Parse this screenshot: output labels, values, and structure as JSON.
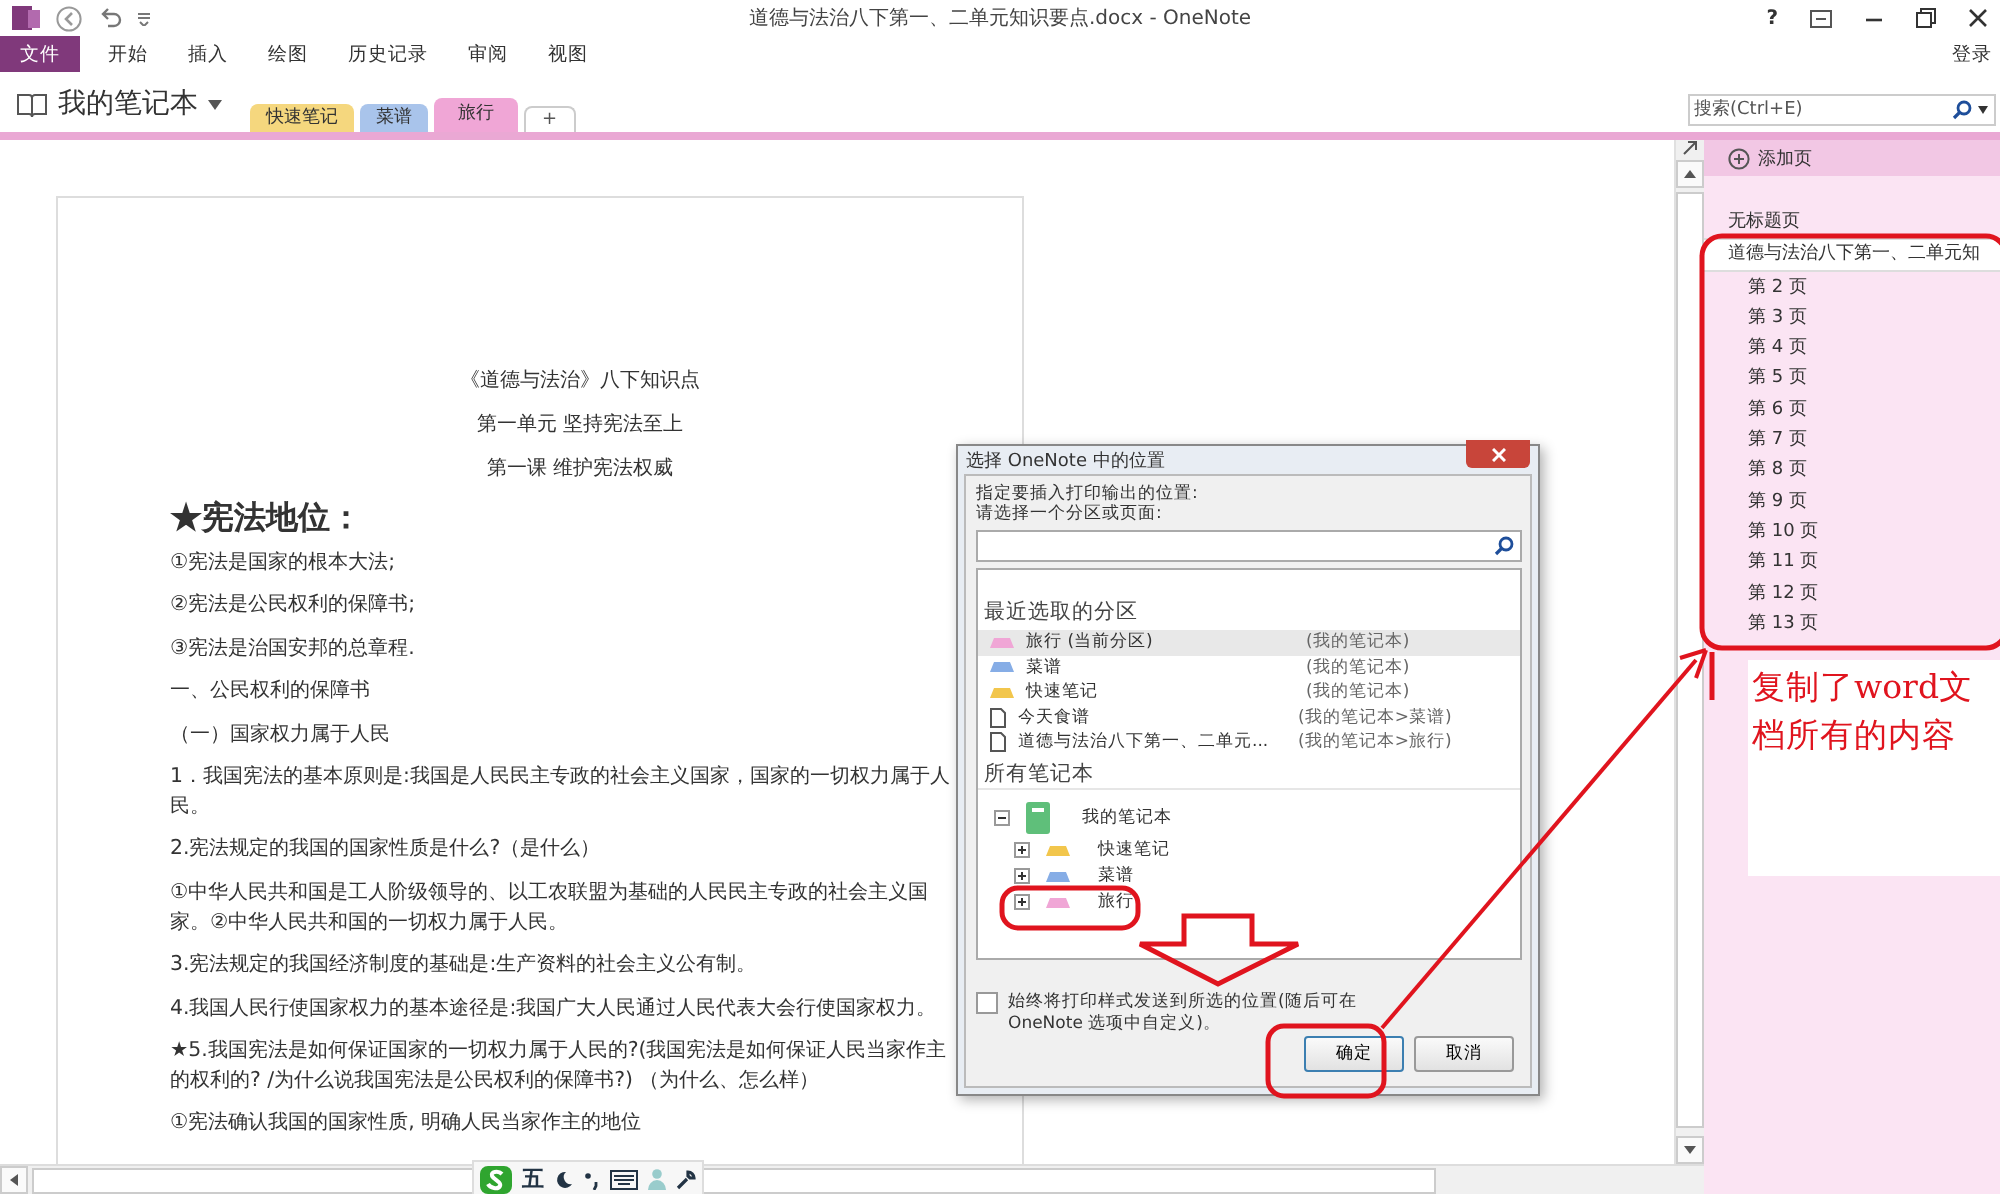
{
  "window": {
    "title": "道德与法治八下第一、二单元知识要点.docx - OneNote",
    "help": "?",
    "sign_in": "登录"
  },
  "ribbon": {
    "tabs": [
      {
        "label": "文件",
        "kind": "file"
      },
      {
        "label": "开始",
        "kind": "tab"
      },
      {
        "label": "插入",
        "kind": "tab"
      },
      {
        "label": "绘图",
        "kind": "tab"
      },
      {
        "label": "历史记录",
        "kind": "tab"
      },
      {
        "label": "审阅",
        "kind": "tab"
      },
      {
        "label": "视图",
        "kind": "tab"
      }
    ]
  },
  "notebook": {
    "name": "我的笔记本",
    "sections": [
      {
        "label": "快速笔记",
        "color": "#f5d77e",
        "selected": false
      },
      {
        "label": "菜谱",
        "color": "#a9c4eb",
        "selected": false
      },
      {
        "label": "旅行",
        "color": "#f0a6d6",
        "selected": true
      }
    ],
    "add_section": "+",
    "search": {
      "placeholder": "搜索(Ctrl+E)"
    }
  },
  "document": {
    "lines": [
      {
        "kind": "title",
        "text": "《道德与法治》八下知识点"
      },
      {
        "kind": "title",
        "text": "第一单元 坚持宪法至上"
      },
      {
        "kind": "title",
        "text": "第一课 维护宪法权威"
      },
      {
        "kind": "heading",
        "text": "★宪法地位："
      },
      {
        "kind": "para",
        "text": "①宪法是国家的根本大法;"
      },
      {
        "kind": "para",
        "text": "②宪法是公民权利的保障书;"
      },
      {
        "kind": "para",
        "text": "③宪法是治国安邦的总章程."
      },
      {
        "kind": "para",
        "text": "一、公民权利的保障书"
      },
      {
        "kind": "para",
        "text": "（一）国家权力属于人民"
      },
      {
        "kind": "para",
        "text": "1．我国宪法的基本原则是:我国是人民民主专政的社会主义国家，国家的一切权力属于人民。"
      },
      {
        "kind": "para",
        "text": "2.宪法规定的我国的国家性质是什么?（是什么）"
      },
      {
        "kind": "para",
        "text": "①中华人民共和国是工人阶级领导的、以工农联盟为基础的人民民主专政的社会主义国家。②中华人民共和国的一切权力属于人民。"
      },
      {
        "kind": "para",
        "text": "3.宪法规定的我国经济制度的基础是:生产资料的社会主义公有制。"
      },
      {
        "kind": "para",
        "text": "4.我国人民行使国家权力的基本途径是:我国广大人民通过人民代表大会行使国家权力。"
      },
      {
        "kind": "para",
        "text": "★5.我国宪法是如何保证国家的一切权力属于人民的?(我国宪法是如何保证人民当家作主的权利的? /为什么说我国宪法是公民权利的保障书?) （为什么、怎么样）"
      },
      {
        "kind": "para",
        "text": "①宪法确认我国的国家性质, 明确人民当家作主的地位"
      }
    ]
  },
  "pages": {
    "add_page": "添加页",
    "items": [
      {
        "title": "无标题页",
        "selected": false
      },
      {
        "title": "道德与法治八下第一、二单元知",
        "selected": true,
        "children": [
          {
            "title": "第 2 页",
            "selected": false
          },
          {
            "title": "第 3 页",
            "selected": false
          },
          {
            "title": "第 4 页",
            "selected": false
          },
          {
            "title": "第 5 页",
            "selected": false
          },
          {
            "title": "第 6 页",
            "selected": false
          },
          {
            "title": "第 7 页",
            "selected": false
          },
          {
            "title": "第 8 页",
            "selected": false
          },
          {
            "title": "第 9 页",
            "selected": false
          },
          {
            "title": "第 10 页",
            "selected": false
          },
          {
            "title": "第 11 页",
            "selected": false
          },
          {
            "title": "第 12 页",
            "selected": false
          },
          {
            "title": "第 13 页",
            "selected": false
          }
        ]
      }
    ]
  },
  "dialog": {
    "title": "选择 OneNote 中的位置",
    "prompt": [
      "指定要插入打印输出的位置:",
      "请选择一个分区或页面:"
    ],
    "recent_heading": "最近选取的分区",
    "recent": [
      {
        "kind": "section",
        "name": "旅行 (当前分区)",
        "location": "(我的笔记本)",
        "color": "#f0a6d6",
        "selected": true
      },
      {
        "kind": "section",
        "name": "菜谱",
        "location": "(我的笔记本)",
        "color": "#86ade6",
        "selected": false
      },
      {
        "kind": "section",
        "name": "快速笔记",
        "location": "(我的笔记本)",
        "color": "#f2c64c",
        "selected": false
      },
      {
        "kind": "page",
        "name": "今天食谱",
        "location": "(我的笔记本>菜谱)",
        "selected": false
      },
      {
        "kind": "page",
        "name": "道德与法治八下第一、二单元...",
        "location": "(我的笔记本>旅行)",
        "selected": false
      }
    ],
    "all_heading": "所有笔记本",
    "tree": {
      "name": "我的笔记本",
      "expanded": true,
      "children": [
        {
          "name": "快速笔记",
          "color": "#f2c64c",
          "expanded": false
        },
        {
          "name": "菜谱",
          "color": "#86ade6",
          "expanded": false
        },
        {
          "name": "旅行",
          "color": "#f0a6d6",
          "expanded": false
        }
      ]
    },
    "checkbox": {
      "label": "始终将打印样式发送到所选的位置(随后可在 OneNote 选项中自定义)。",
      "checked": false
    },
    "buttons": [
      {
        "label": "确定",
        "kind": "primary"
      },
      {
        "label": "取消",
        "kind": "secondary"
      }
    ]
  },
  "annotation": {
    "text": "复制了word文档所有的内容"
  },
  "ime_toolbar": {
    "mode": "五"
  }
}
